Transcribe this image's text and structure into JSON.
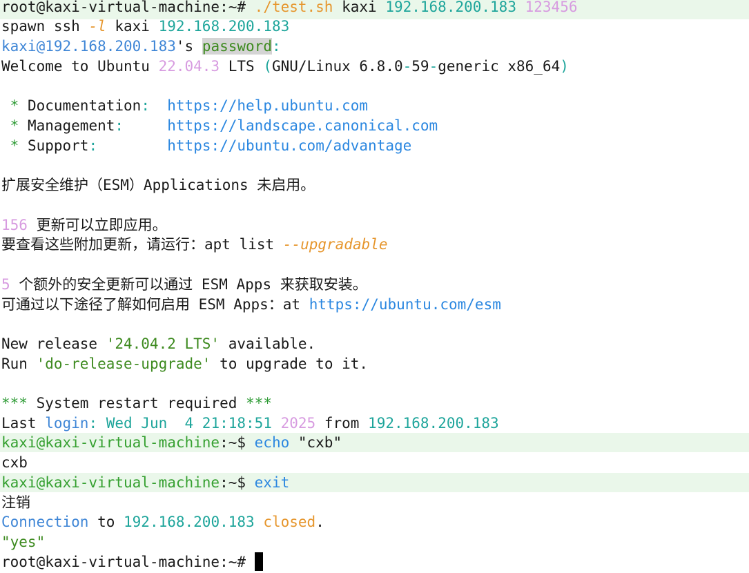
{
  "terminal": {
    "l01": {
      "a": "root@kaxi-virtual-machine:~# ",
      "b": "./test.sh",
      "c": " kaxi ",
      "d": "192.168.200.183",
      "e": " ",
      "f": "123456"
    },
    "l02": {
      "a": "spawn ssh ",
      "b": "-l",
      "c": " kaxi ",
      "d": "192.168.200.183"
    },
    "l03": {
      "a": "kaxi@192.168.200.183",
      "b": "'s ",
      "c": "password",
      "d": ":"
    },
    "l04": {
      "a": "Welcome to Ubuntu ",
      "b": "22.04.3",
      "c": " LTS ",
      "d": "(",
      "e": "GNU/Linux 6.8.0",
      "f": "-",
      "g": "59",
      "h": "-",
      "i": "generic x86_64",
      "j": ")"
    },
    "l06": {
      "a": " * ",
      "b": "Documentation",
      "c": ":",
      "d": "  ",
      "e": "https://help.ubuntu.com"
    },
    "l07": {
      "a": " * ",
      "b": "Management",
      "c": ":",
      "d": "     ",
      "e": "https://landscape.canonical.com"
    },
    "l08": {
      "a": " * ",
      "b": "Support",
      "c": ":",
      "d": "        ",
      "e": "https://ubuntu.com/advantage"
    },
    "l10": {
      "a": "扩展安全维护（ESM）Applications 未启用。"
    },
    "l12": {
      "a": "156",
      "b": " 更新可以立即应用。"
    },
    "l13": {
      "a": "要查看这些附加更新，请运行：apt list ",
      "b": "--upgradable"
    },
    "l15": {
      "a": "5",
      "b": " 个额外的安全更新可以通过 ESM Apps 来获取安装。"
    },
    "l16": {
      "a": "可通过以下途径了解如何启用 ESM Apps：at ",
      "b": "https://ubuntu.com/esm"
    },
    "l18": {
      "a": "New release ",
      "b": "'24.04.2 LTS'",
      "c": " available."
    },
    "l19": {
      "a": "Run ",
      "b": "'do-release-upgrade'",
      "c": " to upgrade to it."
    },
    "l21": {
      "a": "***",
      "b": " System restart required ",
      "c": "***"
    },
    "l22": {
      "a": "Last ",
      "b": "login",
      "c": ":",
      "d": " Wed Jun  4 21:18:51 ",
      "e": "2025",
      "f": " from ",
      "g": "192.168.200.183"
    },
    "l23": {
      "a": "kaxi@kaxi-virtual-machine",
      "b": ":~$ ",
      "c": "echo ",
      "d": "\"cxb\""
    },
    "l24": {
      "a": "cxb"
    },
    "l25": {
      "a": "kaxi@kaxi-virtual-machine",
      "b": ":~$ ",
      "c": "exit"
    },
    "l26": {
      "a": "注销"
    },
    "l27": {
      "a": "Connection",
      "b": " to ",
      "c": "192.168.200.183",
      "d": " ",
      "e": "closed",
      "f": "."
    },
    "l28": {
      "a": "\"yes\""
    },
    "l29": {
      "a": "root@kaxi-virtual-machine:~# "
    }
  }
}
